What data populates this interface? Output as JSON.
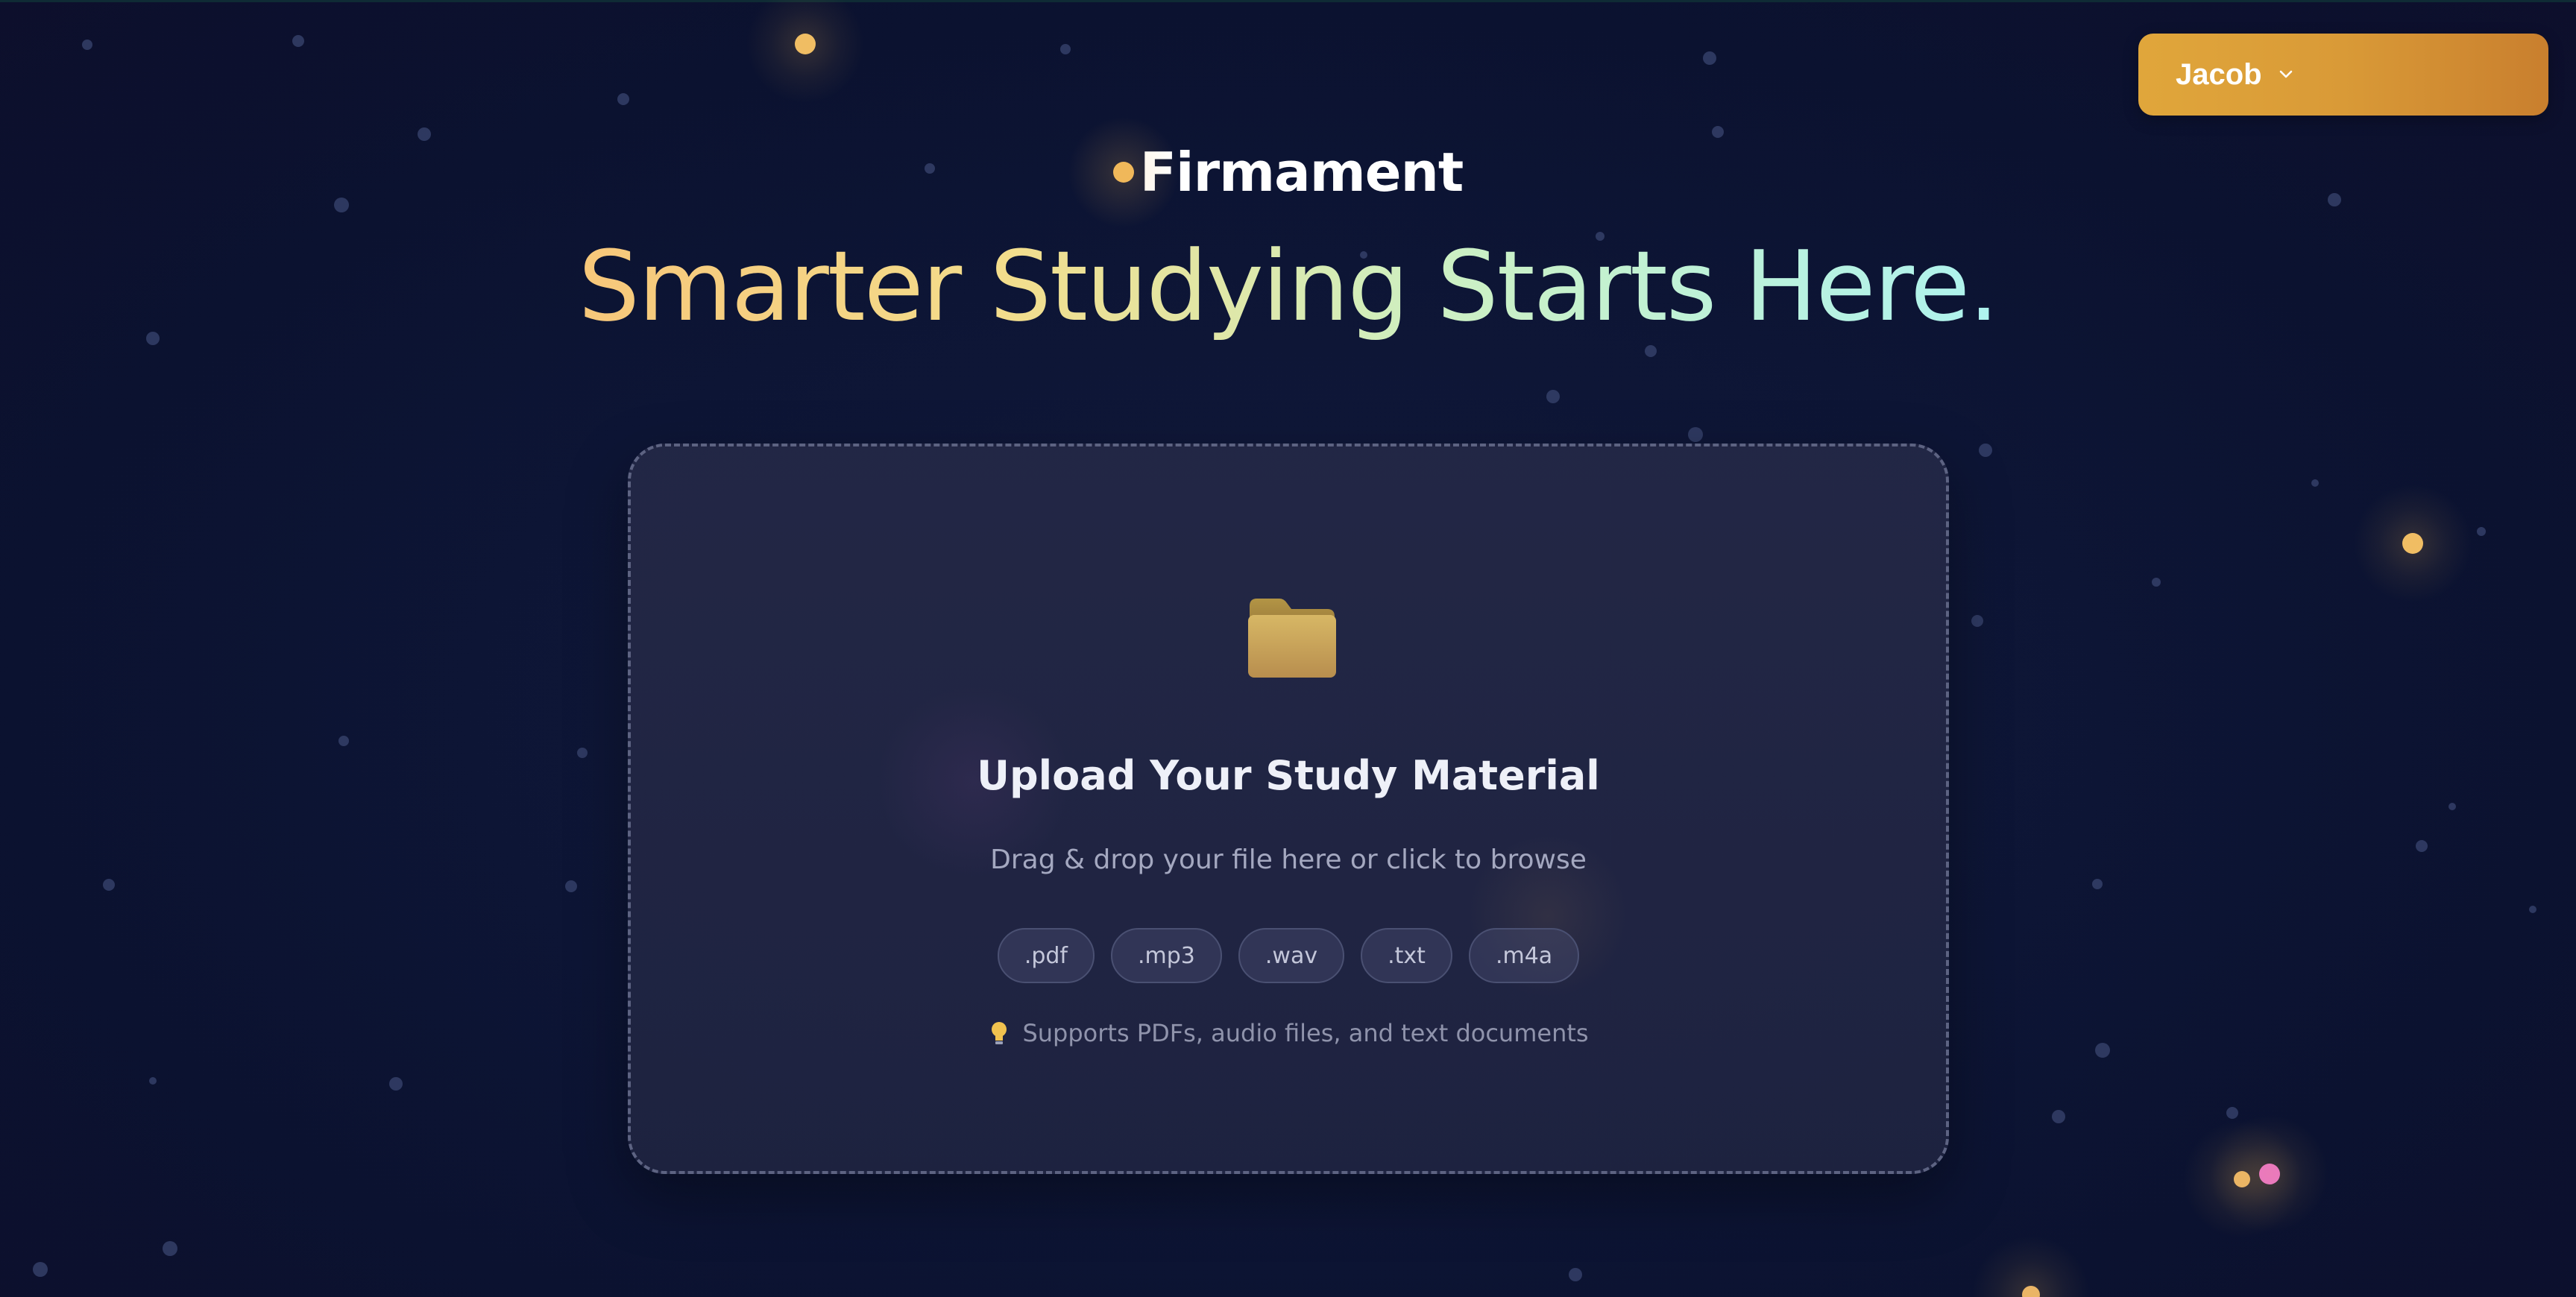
{
  "user_menu": {
    "name": "Jacob",
    "icon": "chevron-down-icon"
  },
  "brand": {
    "name": "Firmament",
    "icon": "star-dot-icon"
  },
  "headline": "Smarter Studying Starts Here.",
  "upload": {
    "icon": "folder-icon",
    "title": "Upload Your Study Material",
    "subtitle": "Drag & drop your file here or click to browse",
    "file_types": [
      ".pdf",
      ".mp3",
      ".wav",
      ".txt",
      ".m4a"
    ],
    "hint_icon": "lightbulb-icon",
    "hint": "Supports PDFs, audio files, and text documents"
  },
  "colors": {
    "background": "#0d1535",
    "accent": "#e0a63b",
    "headline_gradient": [
      "#f7c77a",
      "#aef3ef"
    ]
  }
}
